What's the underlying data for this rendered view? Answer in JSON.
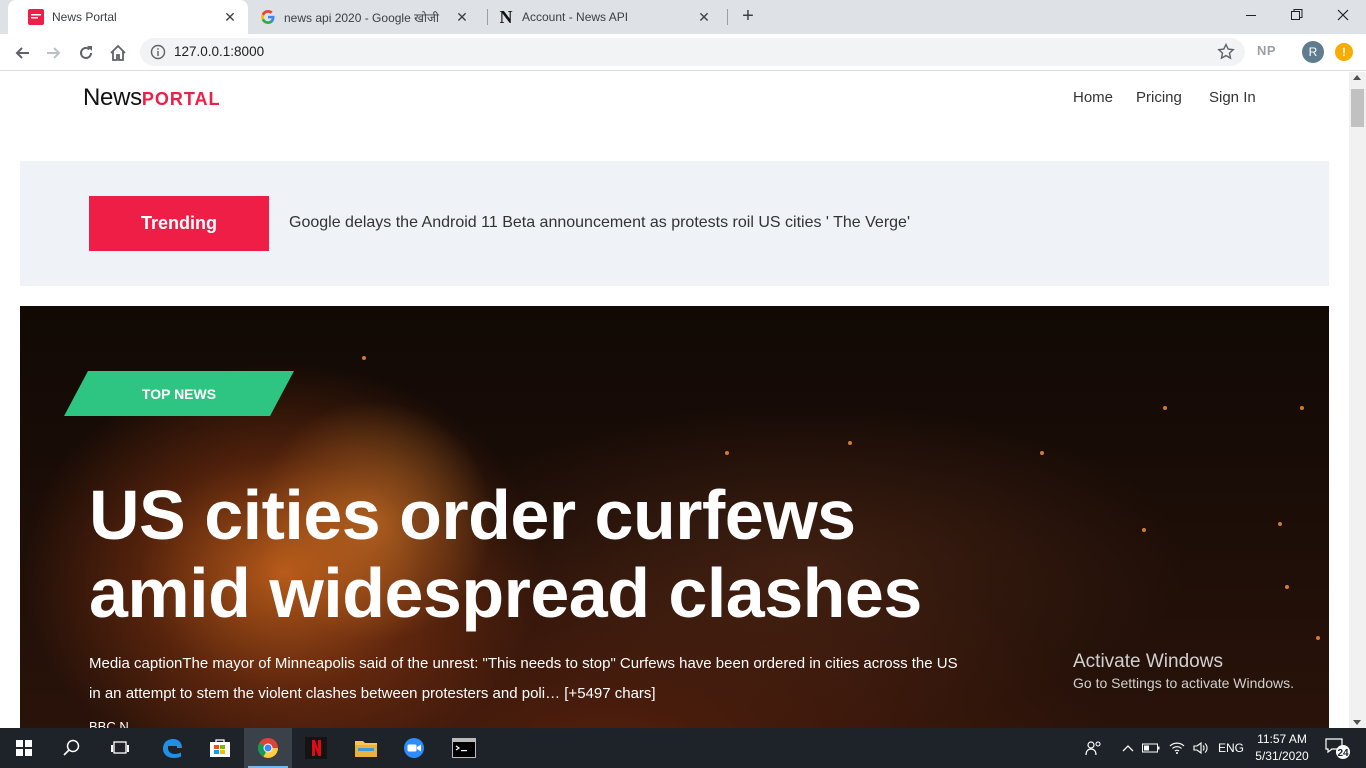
{
  "browser": {
    "tabs": [
      {
        "title": "News Portal",
        "active": true
      },
      {
        "title": "news api 2020 - Google खोजी",
        "active": false
      },
      {
        "title": "Account - News API",
        "active": false
      }
    ],
    "url": "127.0.0.1:8000",
    "extension_label": "NP",
    "profile_initial": "R",
    "alert_badge": "!"
  },
  "site": {
    "logo_text": "News",
    "logo_accent": "PORTAL",
    "nav": [
      "Home",
      "Pricing",
      "Sign In"
    ],
    "trending_label": "Trending",
    "trending_headline": "Google delays the Android 11 Beta announcement as protests roil US cities ' The Verge'",
    "top_news_label": "TOP NEWS",
    "headline": "US cities order curfews amid widespread clashes",
    "summary": "Media captionThe mayor of Minneapolis said of the unrest: \"This needs to stop\" Curfews have been ordered in cities across the US in an attempt to stem the violent clashes between protesters and poli… [+5497 chars]",
    "source": "BBC N...",
    "accent_color": "#ee1e46",
    "top_news_color": "#2ec482"
  },
  "watermark": {
    "line1": "Activate Windows",
    "line2": "Go to Settings to activate Windows."
  },
  "taskbar": {
    "language": "ENG",
    "time": "11:57 AM",
    "date": "5/31/2020",
    "notification_count": "24"
  }
}
